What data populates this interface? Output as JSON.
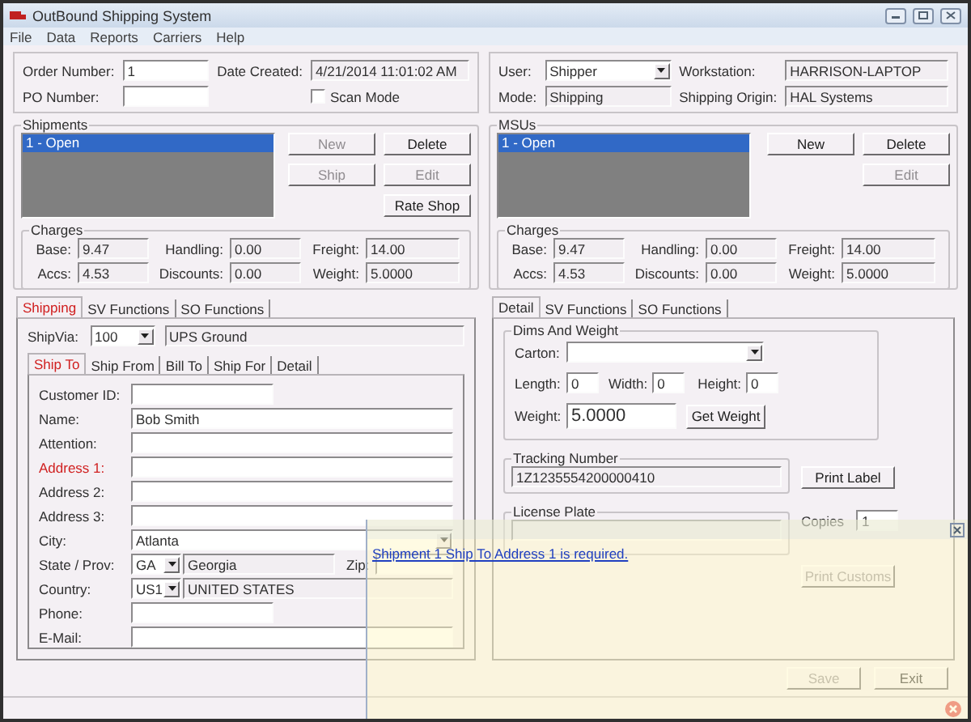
{
  "window": {
    "title": "OutBound Shipping System"
  },
  "menu": [
    "File",
    "Data",
    "Reports",
    "Carriers",
    "Help"
  ],
  "header_left": {
    "order_number": {
      "label": "Order Number:",
      "value": "1"
    },
    "date_created": {
      "label": "Date Created:",
      "value": "4/21/2014 11:01:02 AM"
    },
    "po_number": {
      "label": "PO Number:"
    },
    "scan_mode": {
      "label": "Scan Mode",
      "checked": false
    }
  },
  "header_right": {
    "user": {
      "label": "User:",
      "value": "Shipper"
    },
    "workstation": {
      "label": "Workstation:",
      "value": "HARRISON-LAPTOP"
    },
    "mode": {
      "label": "Mode:",
      "value": "Shipping"
    },
    "shipping_origin": {
      "label": "Shipping Origin:",
      "value": "HAL Systems"
    }
  },
  "shipments": {
    "title": "Shipments",
    "items": [
      {
        "label": "1 - Open",
        "selected": true
      }
    ],
    "button_rows": [
      [
        {
          "label": "New",
          "disabled": true
        },
        {
          "label": "Delete",
          "disabled": false
        }
      ],
      [
        {
          "label": "Ship",
          "disabled": true
        },
        {
          "label": "Edit",
          "disabled": true
        }
      ],
      [
        {
          "label": "Rate Shop",
          "disabled": false
        }
      ]
    ],
    "charges": {
      "title": "Charges",
      "fields": [
        {
          "label": "Base:",
          "value": "9.47"
        },
        {
          "label": "Handling:",
          "value": "0.00"
        },
        {
          "label": "Freight:",
          "value": "14.00"
        },
        {
          "label": "Accs:",
          "value": "4.53"
        },
        {
          "label": "Discounts:",
          "value": "0.00"
        },
        {
          "label": "Weight:",
          "value": "5.0000"
        }
      ]
    }
  },
  "msus": {
    "title": "MSUs",
    "items": [
      {
        "label": "1 - Open",
        "selected": true
      }
    ],
    "button_rows": [
      [
        {
          "label": "New",
          "disabled": false
        },
        {
          "label": "Delete",
          "disabled": false
        }
      ],
      [
        {
          "label": "Edit",
          "disabled": true
        }
      ]
    ],
    "charges": {
      "title": "Charges",
      "fields": [
        {
          "label": "Base:",
          "value": "9.47"
        },
        {
          "label": "Handling:",
          "value": "0.00"
        },
        {
          "label": "Freight:",
          "value": "14.00"
        },
        {
          "label": "Accs:",
          "value": "4.53"
        },
        {
          "label": "Discounts:",
          "value": "0.00"
        },
        {
          "label": "Weight:",
          "value": "5.0000"
        }
      ]
    }
  },
  "left_tabs": [
    {
      "label": "Shipping",
      "selected": true,
      "error": true
    },
    {
      "label": "SV Functions",
      "selected": false,
      "error": false
    },
    {
      "label": "SO Functions",
      "selected": false,
      "error": false
    }
  ],
  "ship_via": {
    "label": "ShipVia:",
    "code": "100",
    "description": "UPS Ground"
  },
  "address_tabs": [
    {
      "label": "Ship To",
      "selected": true,
      "error": true
    },
    {
      "label": "Ship From",
      "selected": false,
      "error": false
    },
    {
      "label": "Bill To",
      "selected": false,
      "error": false
    },
    {
      "label": "Ship For",
      "selected": false,
      "error": false
    },
    {
      "label": "Detail",
      "selected": false,
      "error": false
    }
  ],
  "ship_to": [
    {
      "kind": "short",
      "label": "Customer ID:",
      "error": false
    },
    {
      "kind": "text",
      "label": "Name:",
      "value": "Bob Smith",
      "error": false
    },
    {
      "kind": "text",
      "label": "Attention:",
      "error": false
    },
    {
      "kind": "text",
      "label": "Address 1:",
      "error": true
    },
    {
      "kind": "text",
      "label": "Address 2:",
      "error": false
    },
    {
      "kind": "text",
      "label": "Address 3:",
      "error": false
    },
    {
      "kind": "combo",
      "label": "City:",
      "value": "Atlanta",
      "error": false
    },
    {
      "kind": "state",
      "label": "State / Prov:",
      "code": "GA",
      "name": "Georgia",
      "zip_label": "Zip:",
      "error": false
    },
    {
      "kind": "country",
      "label": "Country:",
      "code": "US1",
      "name": "UNITED STATES",
      "error": false
    },
    {
      "kind": "short",
      "label": "Phone:",
      "error": false
    },
    {
      "kind": "text",
      "label": "E-Mail:",
      "error": false
    }
  ],
  "right_tabs": [
    {
      "label": "Detail",
      "selected": true,
      "error": false
    },
    {
      "label": "SV Functions",
      "selected": false,
      "error": false
    },
    {
      "label": "SO Functions",
      "selected": false,
      "error": false
    }
  ],
  "dims": {
    "title": "Dims And Weight",
    "carton_label": "Carton:",
    "length": {
      "label": "Length:",
      "value": "0"
    },
    "width": {
      "label": "Width:",
      "value": "0"
    },
    "height": {
      "label": "Height:",
      "value": "0"
    },
    "weight": {
      "label": "Weight:",
      "value": "5.0000"
    },
    "get_weight": {
      "label": "Get Weight",
      "disabled": false
    }
  },
  "tracking": {
    "title": "Tracking Number",
    "value": "1Z1235554200000410",
    "print_label": {
      "label": "Print Label",
      "disabled": false
    }
  },
  "license_plate": {
    "title": "License Plate",
    "copies_label": "Copies",
    "copies": "1"
  },
  "print_customs": {
    "label": "Print Customs",
    "disabled": true
  },
  "footer_buttons": [
    {
      "label": "Save",
      "disabled": true
    },
    {
      "label": "Exit",
      "disabled": false
    }
  ],
  "notification": {
    "message": "Shipment 1 Ship To Address 1 is required."
  }
}
